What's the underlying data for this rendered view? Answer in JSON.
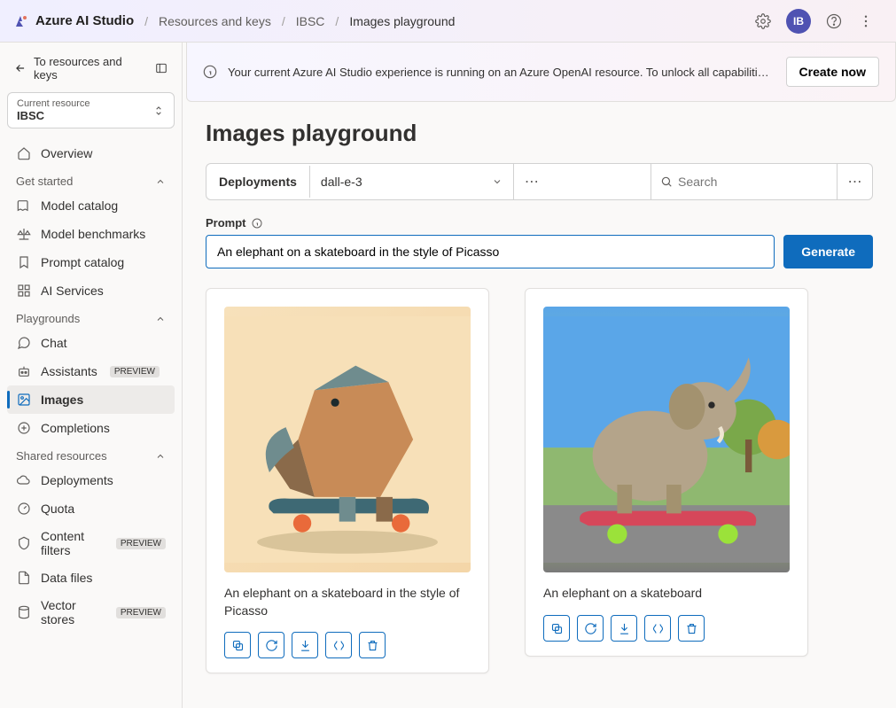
{
  "header": {
    "brand": "Azure AI Studio",
    "crumbs": [
      "Resources and keys",
      "IBSC",
      "Images playground"
    ],
    "avatar_initials": "IB"
  },
  "banner": {
    "message": "Your current Azure AI Studio experience is running on an Azure OpenAI resource. To unlock all capabilities, create a...",
    "create_label": "Create now"
  },
  "sidebar": {
    "back_label": "To resources and keys",
    "current_resource_label": "Current resource",
    "current_resource_value": "IBSC",
    "overview_label": "Overview",
    "sections": {
      "get_started": {
        "title": "Get started",
        "items": [
          "Model catalog",
          "Model benchmarks",
          "Prompt catalog",
          "AI Services"
        ]
      },
      "playgrounds": {
        "title": "Playgrounds",
        "items": [
          "Chat",
          "Assistants",
          "Images",
          "Completions"
        ],
        "preview_flags": [
          false,
          true,
          false,
          false
        ],
        "active_index": 2
      },
      "shared": {
        "title": "Shared resources",
        "items": [
          "Deployments",
          "Quota",
          "Content filters",
          "Data files",
          "Vector stores"
        ],
        "preview_flags": [
          false,
          false,
          true,
          false,
          true
        ]
      }
    },
    "preview_badge": "PREVIEW"
  },
  "page": {
    "title": "Images playground",
    "deployments_label": "Deployments",
    "deployment_value": "dall-e-3",
    "search_placeholder": "Search",
    "prompt_label": "Prompt",
    "prompt_value": "An elephant on a skateboard in the style of Picasso",
    "generate_label": "Generate"
  },
  "results": [
    {
      "caption": "An elephant on a skateboard in the style of Picasso"
    },
    {
      "caption": "An elephant on a skateboard"
    }
  ],
  "card_action_names": [
    "copy-icon",
    "regenerate-icon",
    "download-icon",
    "code-icon",
    "delete-icon"
  ]
}
